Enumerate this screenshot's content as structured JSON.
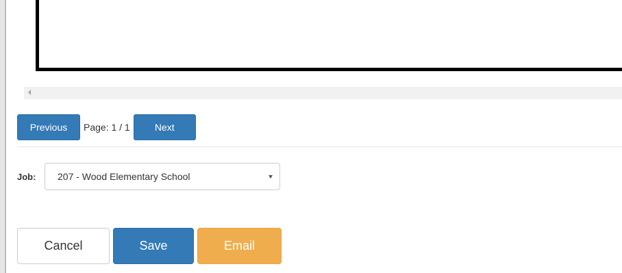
{
  "pager": {
    "previous_label": "Previous",
    "page_text": "Page: 1 / 1",
    "next_label": "Next"
  },
  "job": {
    "label": "Job:",
    "selected": "207 - Wood Elementary School"
  },
  "actions": {
    "cancel_label": "Cancel",
    "save_label": "Save",
    "email_label": "Email"
  },
  "colors": {
    "primary": "#337ab7",
    "warning": "#f0ad4e"
  }
}
